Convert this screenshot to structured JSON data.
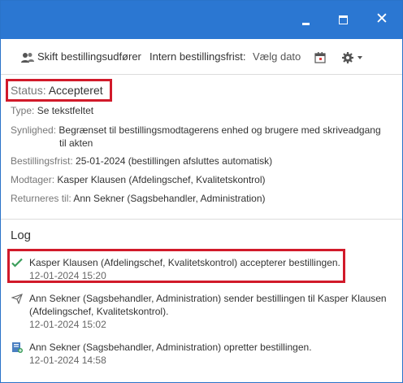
{
  "window": {
    "close_glyph": "✕"
  },
  "toolbar": {
    "change_orderer": "Skift bestillingsudfører",
    "internal_deadline_label": "Intern bestillingsfrist:",
    "date_placeholder": "Vælg dato"
  },
  "status": {
    "label": "Status:",
    "value": "Accepteret"
  },
  "details": {
    "type_label": "Type:",
    "type_value": "Se tekstfeltet",
    "visibility_label": "Synlighed:",
    "visibility_value_1": "Begrænset til bestillingsmodtagerens enhed og brugere med skriveadgang",
    "visibility_value_2": "til akten",
    "deadline_label": "Bestillingsfrist:",
    "deadline_value": "25-01-2024 (bestillingen afsluttes automatisk)",
    "recipient_label": "Modtager:",
    "recipient_value": "Kasper Klausen (Afdelingschef, Kvalitetskontrol)",
    "return_label": "Returneres til:",
    "return_value": "Ann Sekner (Sagsbehandler, Administration)"
  },
  "log": {
    "title": "Log",
    "entries": [
      {
        "icon": "check-icon",
        "line1": "Kasper Klausen (Afdelingschef, Kvalitetskontrol) accepterer bestillingen.",
        "time": "12-01-2024 15:20"
      },
      {
        "icon": "send-icon",
        "line1": "Ann Sekner (Sagsbehandler, Administration) sender bestillingen til Kasper Klausen",
        "line2": "(Afdelingschef, Kvalitetskontrol).",
        "time": "12-01-2024 15:02"
      },
      {
        "icon": "create-document-icon",
        "line1": "Ann Sekner (Sagsbehandler, Administration) opretter bestillingen.",
        "time": "12-01-2024 14:58"
      }
    ]
  },
  "colors": {
    "titlebar": "#2b77d2",
    "highlight": "#d11a2a",
    "check": "#3a9d5a"
  }
}
